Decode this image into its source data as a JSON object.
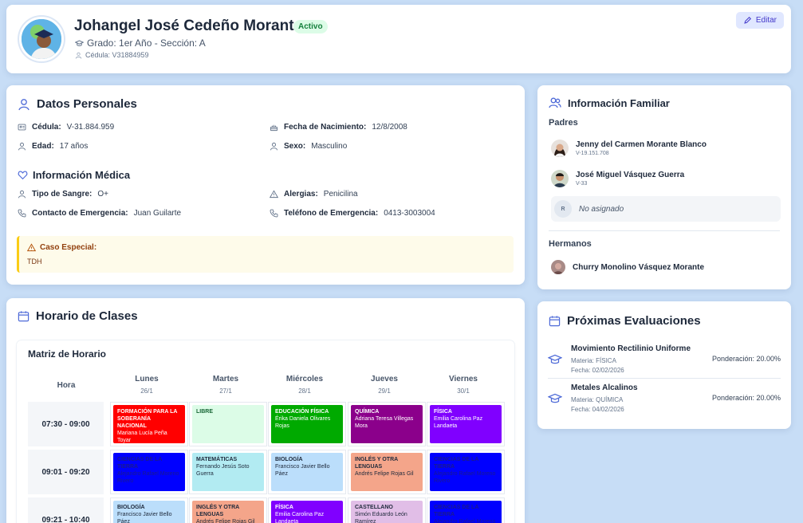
{
  "header": {
    "name": "Johangel José Cedeño Morante",
    "status": "Activo",
    "grade": "Grado: 1er Año - Sección: A",
    "cedula": "Cédula: V31884959",
    "edit_label": "Editar"
  },
  "personal": {
    "title": "Datos Personales",
    "cedula_label": "Cédula:",
    "cedula_value": "V-31.884.959",
    "birth_label": "Fecha de Nacimiento:",
    "birth_value": "12/8/2008",
    "age_label": "Edad:",
    "age_value": "17 años",
    "sex_label": "Sexo:",
    "sex_value": "Masculino",
    "medical_title": "Información Médica",
    "blood_label": "Tipo de Sangre:",
    "blood_value": "O+",
    "allergy_label": "Alergias:",
    "allergy_value": "Penicilina",
    "contact_label": "Contacto de Emergencia:",
    "contact_value": "Juan Guilarte",
    "phone_label": "Teléfono de Emergencia:",
    "phone_value": "0413-3003004",
    "special_title": "Caso Especial:",
    "special_text": "TDH"
  },
  "family": {
    "title": "Información Familiar",
    "parents_label": "Padres",
    "parents": [
      {
        "name": "Jenny del Carmen Morante Blanco",
        "id": "V-19.151.708"
      },
      {
        "name": "José Miguel Vásquez Guerra",
        "id": "V-33"
      },
      {
        "initial": "R",
        "name": "No asignado"
      }
    ],
    "siblings_label": "Hermanos",
    "siblings": [
      {
        "name": "Churry Monolino Vásquez Morante"
      }
    ]
  },
  "schedule": {
    "title": "Horario de Clases",
    "matrix_title": "Matriz de Horario",
    "hour_label": "Hora",
    "days": [
      {
        "name": "Lunes",
        "date": "26/1"
      },
      {
        "name": "Martes",
        "date": "27/1"
      },
      {
        "name": "Miércoles",
        "date": "28/1"
      },
      {
        "name": "Jueves",
        "date": "29/1"
      },
      {
        "name": "Viernes",
        "date": "30/1"
      }
    ],
    "rows": [
      {
        "hour": "07:30 - 09:00",
        "slots": [
          {
            "subject": "FORMACIÓN PARA LA SOBERANÍA NACIONAL",
            "teacher": "Mariana Lucía Peña Toyar",
            "bg": "#ff0000",
            "fg": "#ffffff"
          },
          {
            "subject": "LIBRE",
            "teacher": "",
            "bg": "#dcfce7",
            "fg": "#166534"
          },
          {
            "subject": "EDUCACIÓN FÍSICA",
            "teacher": "Érika Daniela Olivares Rojas",
            "bg": "#00aa00",
            "fg": "#ffffff"
          },
          {
            "subject": "QUÍMICA",
            "teacher": "Adriana Teresa Villegas Mora",
            "bg": "#8b008b",
            "fg": "#ffffff"
          },
          {
            "subject": "FÍSICA",
            "teacher": "Emilia Carolina Paz Landaeta",
            "bg": "#8000ff",
            "fg": "#ffffff"
          }
        ]
      },
      {
        "hour": "09:01 - 09:20",
        "slots": [
          {
            "subject": "CIENCIAS DE LA TIERRA",
            "teacher": "Alejandro Rafael Moreno Rivero",
            "bg": "#0000ff",
            "fg": "#1a1a8c"
          },
          {
            "subject": "MATEMÁTICAS",
            "teacher": "Fernando Jesús Soto Guerra",
            "bg": "#b2ebf2",
            "fg": "#1e293b"
          },
          {
            "subject": "BIOLOGÍA",
            "teacher": "Francisco Javier Bello Páez",
            "bg": "#bbdefb",
            "fg": "#1e293b"
          },
          {
            "subject": "INGLÉS Y OTRA LENGUAS",
            "teacher": "Andrés Felipe Rojas Gil",
            "bg": "#f4a58a",
            "fg": "#1e293b"
          },
          {
            "subject": "CIENCIAS DE LA TIERRA",
            "teacher": "Alejandro Rafael Moreno Rivero",
            "bg": "#0000ff",
            "fg": "#1a1a8c"
          }
        ]
      },
      {
        "hour": "09:21 - 10:40",
        "slots": [
          {
            "subject": "BIOLOGÍA",
            "teacher": "Francisco Javier Bello Páez",
            "bg": "#bbdefb",
            "fg": "#1e293b"
          },
          {
            "subject": "INGLÉS Y OTRA LENGUAS",
            "teacher": "Andrés Felipe Rojas Gil",
            "bg": "#f4a58a",
            "fg": "#1e293b"
          },
          {
            "subject": "FÍSICA",
            "teacher": "Emilia Carolina Paz Landaeta",
            "bg": "#8000ff",
            "fg": "#ffffff"
          },
          {
            "subject": "CASTELLANO",
            "teacher": "Simón Eduardo León Ramírez",
            "bg": "#e1bee7",
            "fg": "#1e293b"
          },
          {
            "subject": "CIENCIAS DE LA TIERRA",
            "teacher": "Alejandro Rafael Moreno Rivero",
            "bg": "#0000ff",
            "fg": "#1a1a8c"
          }
        ]
      }
    ]
  },
  "exams": {
    "title": "Próximas Evaluaciones",
    "items": [
      {
        "title": "Movimiento Rectilinio Uniforme",
        "subject": "Materia: FÍSICA",
        "date": "Fecha: 02/02/2026",
        "weight": "Ponderación: 20.00%"
      },
      {
        "title": "Metales Alcalinos",
        "subject": "Materia: QUÍMICA",
        "date": "Fecha: 04/02/2026",
        "weight": "Ponderación: 20.00%"
      }
    ]
  },
  "colors": {
    "accent": "#4338ca",
    "background": "#c7ddf6"
  }
}
